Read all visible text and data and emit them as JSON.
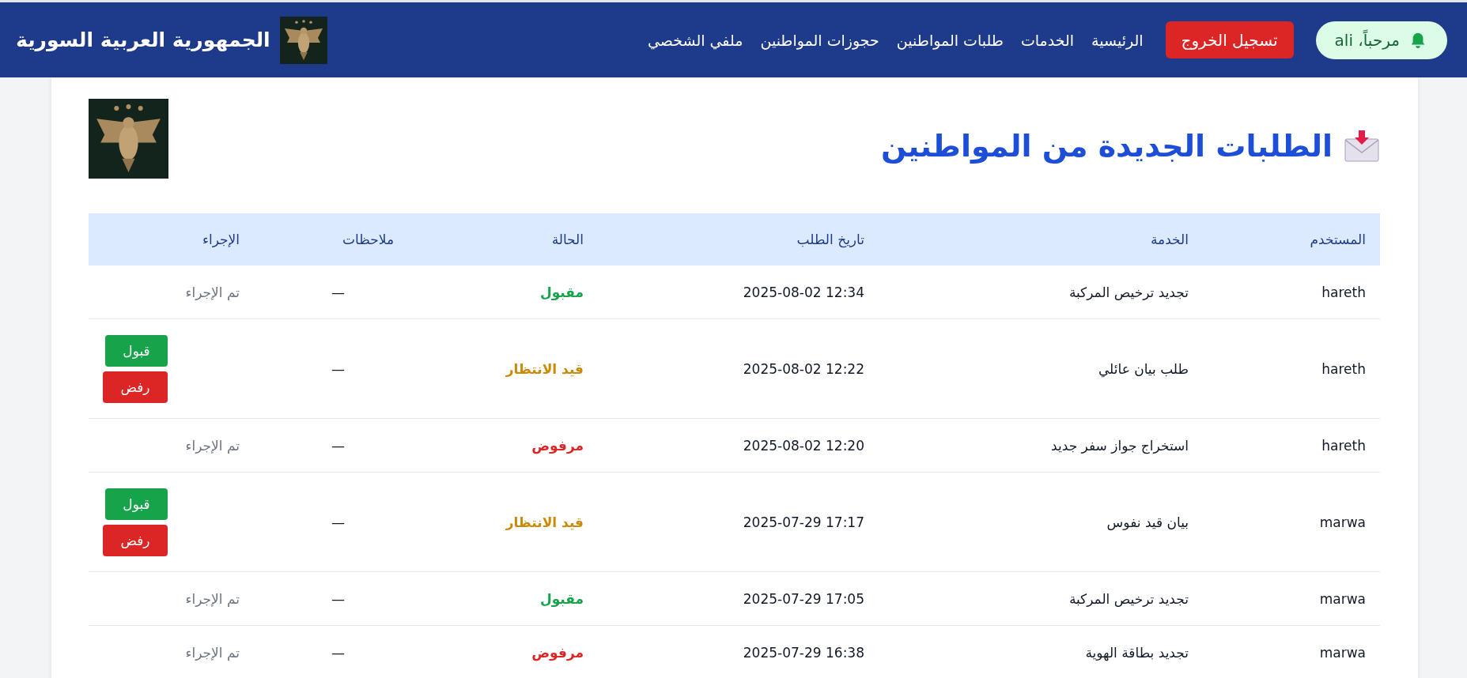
{
  "header": {
    "greeting": "مرحباً، ali",
    "logout": "تسجيل الخروج",
    "nav": [
      {
        "label": "الرئيسية"
      },
      {
        "label": "الخدمات"
      },
      {
        "label": "طلبات المواطنين"
      },
      {
        "label": "حجوزات المواطنين"
      },
      {
        "label": "ملفي الشخصي"
      }
    ],
    "brand": "الجمهورية العربية السورية"
  },
  "page": {
    "title": "الطلبات الجديدة من المواطنين"
  },
  "table": {
    "columns": [
      "المستخدم",
      "الخدمة",
      "تاريخ الطلب",
      "الحالة",
      "ملاحظات",
      "الإجراء"
    ],
    "rows": [
      {
        "user": "hareth",
        "service": "تجديد ترخيص المركبة",
        "date": "2025-08-02 12:34",
        "status": {
          "kind": "accepted",
          "label": "مقبول"
        },
        "notes": "—",
        "action": "تم الإجراء"
      },
      {
        "user": "hareth",
        "service": "طلب بيان عائلي",
        "date": "2025-08-02 12:22",
        "status": {
          "kind": "pending",
          "label": "قيد الانتظار"
        },
        "notes": "—",
        "buttons": {
          "accept": "قبول",
          "reject": "رفض"
        }
      },
      {
        "user": "hareth",
        "service": "استخراج جواز سفر جديد",
        "date": "2025-08-02 12:20",
        "status": {
          "kind": "rejected",
          "label": "مرفوض"
        },
        "notes": "—",
        "action": "تم الإجراء"
      },
      {
        "user": "marwa",
        "service": "بيان قيد نفوس",
        "date": "2025-07-29 17:17",
        "status": {
          "kind": "pending",
          "label": "قيد الانتظار"
        },
        "notes": "—",
        "buttons": {
          "accept": "قبول",
          "reject": "رفض"
        }
      },
      {
        "user": "marwa",
        "service": "تجديد ترخيص المركبة",
        "date": "2025-07-29 17:05",
        "status": {
          "kind": "accepted",
          "label": "مقبول"
        },
        "notes": "—",
        "action": "تم الإجراء"
      },
      {
        "user": "marwa",
        "service": "تجديد بطاقة الهوية",
        "date": "2025-07-29 16:38",
        "status": {
          "kind": "rejected",
          "label": "مرفوض"
        },
        "notes": "—",
        "action": "تم الإجراء"
      }
    ]
  }
}
